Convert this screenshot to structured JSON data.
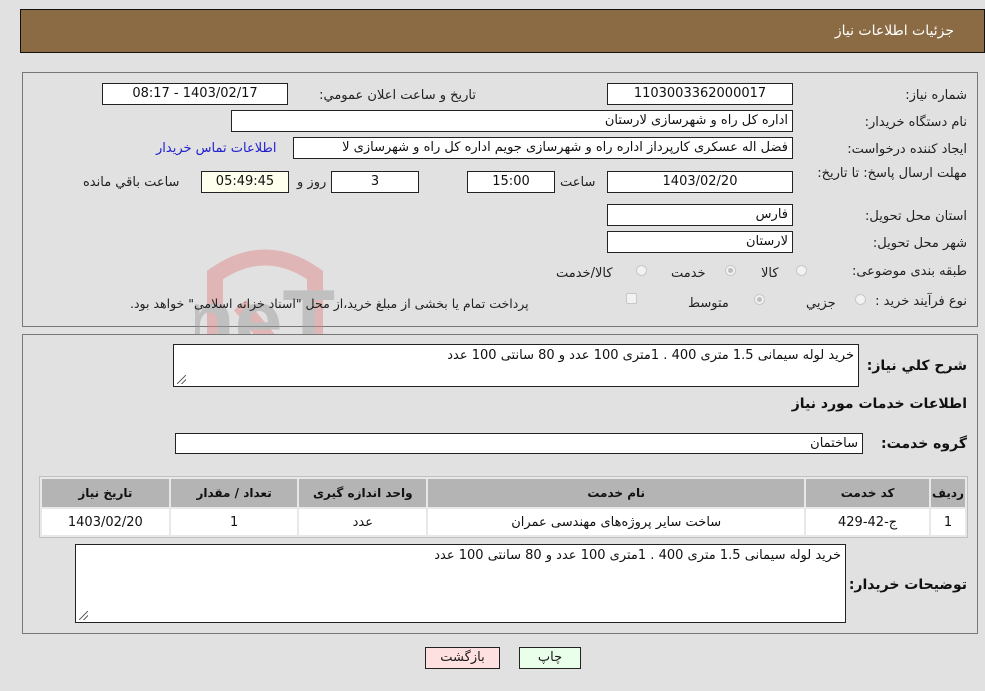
{
  "header": {
    "title": "جزئیات اطلاعات نیاز"
  },
  "form": {
    "need_number": {
      "label": "شماره نیاز:",
      "value": "1103003362000017"
    },
    "announce_datetime": {
      "label": "تاریخ و ساعت اعلان عمومي:",
      "value": "1403/02/17 - 08:17"
    },
    "buyer_org": {
      "label": "نام دستگاه خریدار:",
      "value": "اداره کل راه و شهرسازی لارستان"
    },
    "requester": {
      "label": "ایجاد کننده درخواست:",
      "value": "فضل اله عسکری کارپرداز اداره راه و شهرسازی جویم اداره کل راه و شهرسازی لا"
    },
    "buyer_contact_link": "اطلاعات تماس خریدار",
    "deadline": {
      "label": "مهلت ارسال پاسخ: تا تاریخ:",
      "date": "1403/02/20",
      "time_label": "ساعت",
      "time": "15:00",
      "days": "3",
      "days_label": "روز و",
      "remaining": "05:49:45",
      "remaining_label": "ساعت باقي مانده"
    },
    "province": {
      "label": "استان محل تحویل:",
      "value": "فارس"
    },
    "city": {
      "label": "شهر محل تحویل:",
      "value": "لارستان"
    },
    "category": {
      "label": "طبقه بندی موضوعی:",
      "options": [
        "کالا",
        "خدمت",
        "کالا/خدمت"
      ],
      "selected": "خدمت"
    },
    "purchase_type": {
      "label": "نوع فرآیند خرید :",
      "options": [
        "جزيي",
        "متوسط"
      ],
      "selected": "متوسط",
      "treasury_note": "پرداخت تمام یا بخشی از مبلغ خرید،از محل \"اسناد خزانه اسلامی\" خواهد بود."
    }
  },
  "details": {
    "description_label": "شرح کلي نیاز:",
    "description": "خرید  لوله سیمانی  1.5 متری 400 . 1متری 100 عدد و 80 سانتی 100 عدد",
    "services_heading": "اطلاعات خدمات مورد نیاز",
    "service_group_label": "گروه خدمت:",
    "service_group": "ساختمان",
    "table": {
      "headers": [
        "ردیف",
        "کد خدمت",
        "نام خدمت",
        "واحد اندازه گیری",
        "تعداد / مقدار",
        "تاریخ نیاز"
      ],
      "rows": [
        [
          "1",
          "ج-42-429",
          "ساخت سایر پروژه‌های مهندسی عمران",
          "عدد",
          "1",
          "1403/02/20"
        ]
      ]
    },
    "buyer_notes_label": "توضیحات خریدار:",
    "buyer_notes": "خرید  لوله سیمانی  1.5 متری 400 . 1متری 100 عدد و 80 سانتی 100 عدد"
  },
  "buttons": {
    "print": "چاپ",
    "back": "بازگشت"
  },
  "watermark": {
    "text": "AriaTender.neT"
  },
  "colors": {
    "header_bg": "#8b6b43",
    "link": "#2020d0",
    "back_btn": "#ffe0e0",
    "print_btn": "#eaffea"
  }
}
